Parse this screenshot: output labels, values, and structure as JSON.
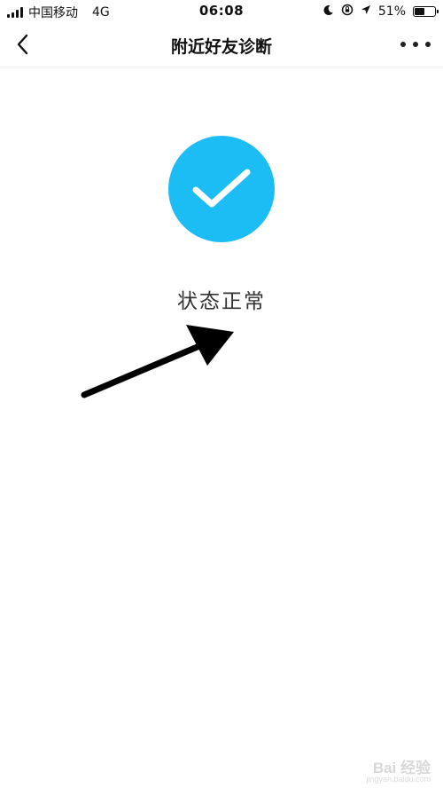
{
  "status_bar": {
    "carrier": "中国移动",
    "network": "4G",
    "time": "06:08",
    "battery_percent_label": "51%",
    "battery_level": 0.51,
    "icons": [
      "signal-icon",
      "moon-icon",
      "rotation-lock-icon",
      "location-icon",
      "battery-icon"
    ]
  },
  "nav": {
    "title": "附近好友诊断",
    "back_icon": "chevron-left-icon",
    "more_icon": "more-dots-icon"
  },
  "main": {
    "status_icon": "checkmark-icon",
    "status_text": "状态正常",
    "accent_color": "#1cbcf5"
  },
  "watermark": {
    "logo_text": "Bai 经验",
    "sub_text": "jingyan.baidu.com"
  }
}
